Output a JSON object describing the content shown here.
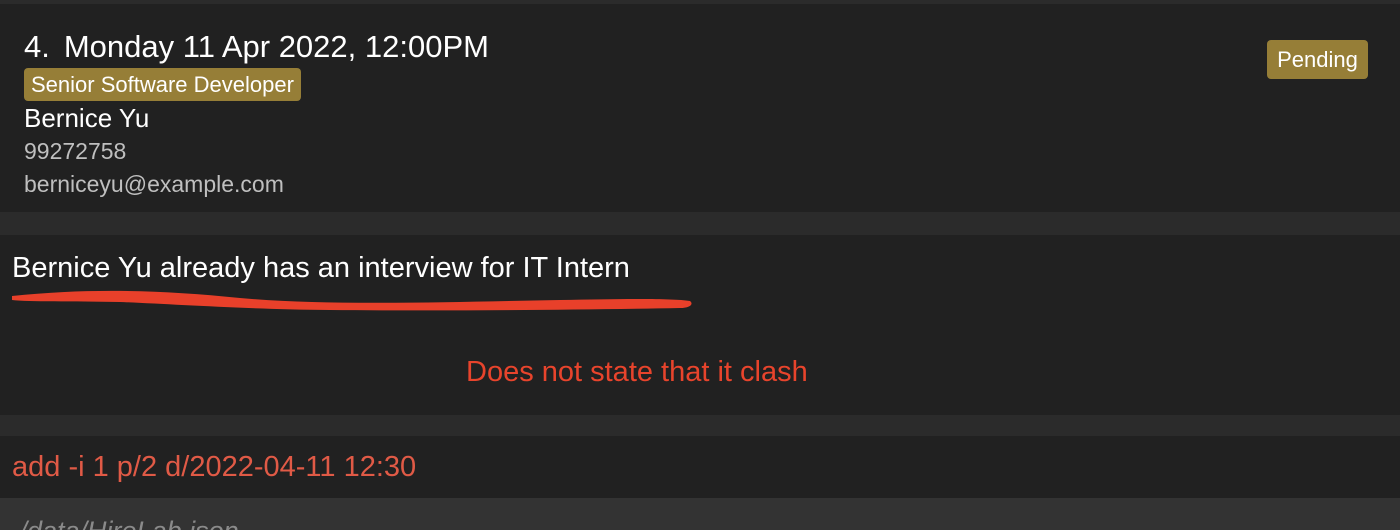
{
  "interview_card": {
    "index": "4.",
    "datetime": "Monday 11 Apr 2022, 12:00PM",
    "role": "Senior Software Developer",
    "status": "Pending",
    "candidate_name": "Bernice Yu",
    "phone": "99272758",
    "email": "berniceyu@example.com"
  },
  "result": {
    "message": "Bernice Yu already has an interview for IT Intern",
    "annotation": "Does not state that it clash",
    "annotation_color": "#e8442c"
  },
  "command": {
    "value": "add -i 1 p/2 d/2022-04-11 12:30"
  },
  "footer": {
    "save_path": "./data/HireLab.json"
  },
  "colors": {
    "tag_bg": "#967e37",
    "panel_bg": "#212121",
    "command_text": "#e05a46"
  }
}
